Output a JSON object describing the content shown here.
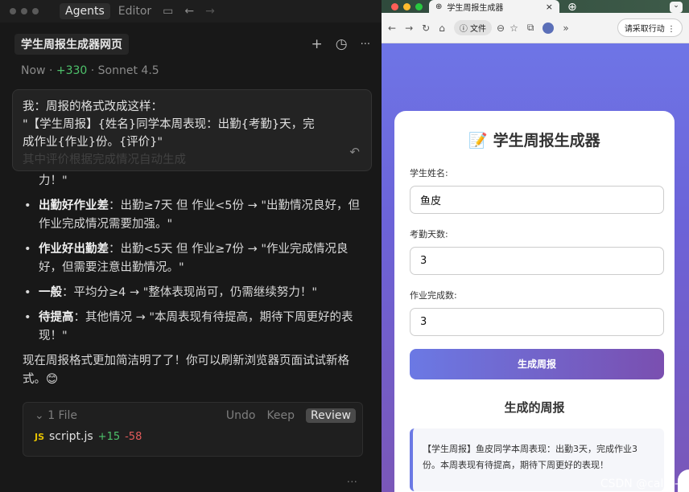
{
  "editor": {
    "tabs": {
      "agents": "Agents",
      "editor": "Editor"
    },
    "title": "学生周报生成器网页",
    "meta": {
      "time": "Now",
      "added": "+330",
      "model": "Sonnet 4.5"
    },
    "user_message": [
      "我：周报的格式改成这样：",
      "\"【学生周报】{姓名}同学本周表现：出勤{考勤}天，完",
      "成作业{作业}份。{评价}\"",
      "其中评价根据完成情况自动生成"
    ],
    "continuation": "力！\"",
    "bullets": [
      {
        "bold": "出勤好作业差",
        "text": "：出勤≥7天 但 作业<5份 → \"出勤情况良好，但作业完成情况需要加强。\""
      },
      {
        "bold": "作业好出勤差",
        "text": "：出勤<5天 但 作业≥7份 → \"作业完成情况良好，但需要注意出勤情况。\""
      },
      {
        "bold": "一般",
        "text": "：平均分≥4 → \"整体表现尚可，仍需继续努力！\""
      },
      {
        "bold": "待提高",
        "text": "：其他情况 → \"本周表现有待提高，期待下周更好的表现！\""
      }
    ],
    "summary": "现在周报格式更加简洁明了了！你可以刷新浏览器页面试试新格式。😊",
    "file_changes": {
      "count": "1 File",
      "undo": "Undo",
      "keep": "Keep",
      "review": "Review",
      "file_icon": "JS",
      "file_name": "script.js",
      "additions": "+15",
      "deletions": "-58"
    },
    "more": "..."
  },
  "browser": {
    "tab_title": "学生周报生成器",
    "address_chip": "文件",
    "action_chip": "请采取行动",
    "colors": {
      "red": "#ff5f57",
      "yellow": "#febc2e",
      "green": "#28c840"
    }
  },
  "app": {
    "title": "📝 学生周报生成器",
    "fields": [
      {
        "label": "学生姓名:",
        "value": "鱼皮"
      },
      {
        "label": "考勤天数:",
        "value": "3"
      },
      {
        "label": "作业完成数:",
        "value": "3"
      }
    ],
    "button": "生成周报",
    "result_title": "生成的周报",
    "result_text": "【学生周报】鱼皮同学本周表现：出勤3天，完成作业3份。本周表现有待提高，期待下周更好的表现！"
  },
  "watermark": "CSDN @calm-1"
}
